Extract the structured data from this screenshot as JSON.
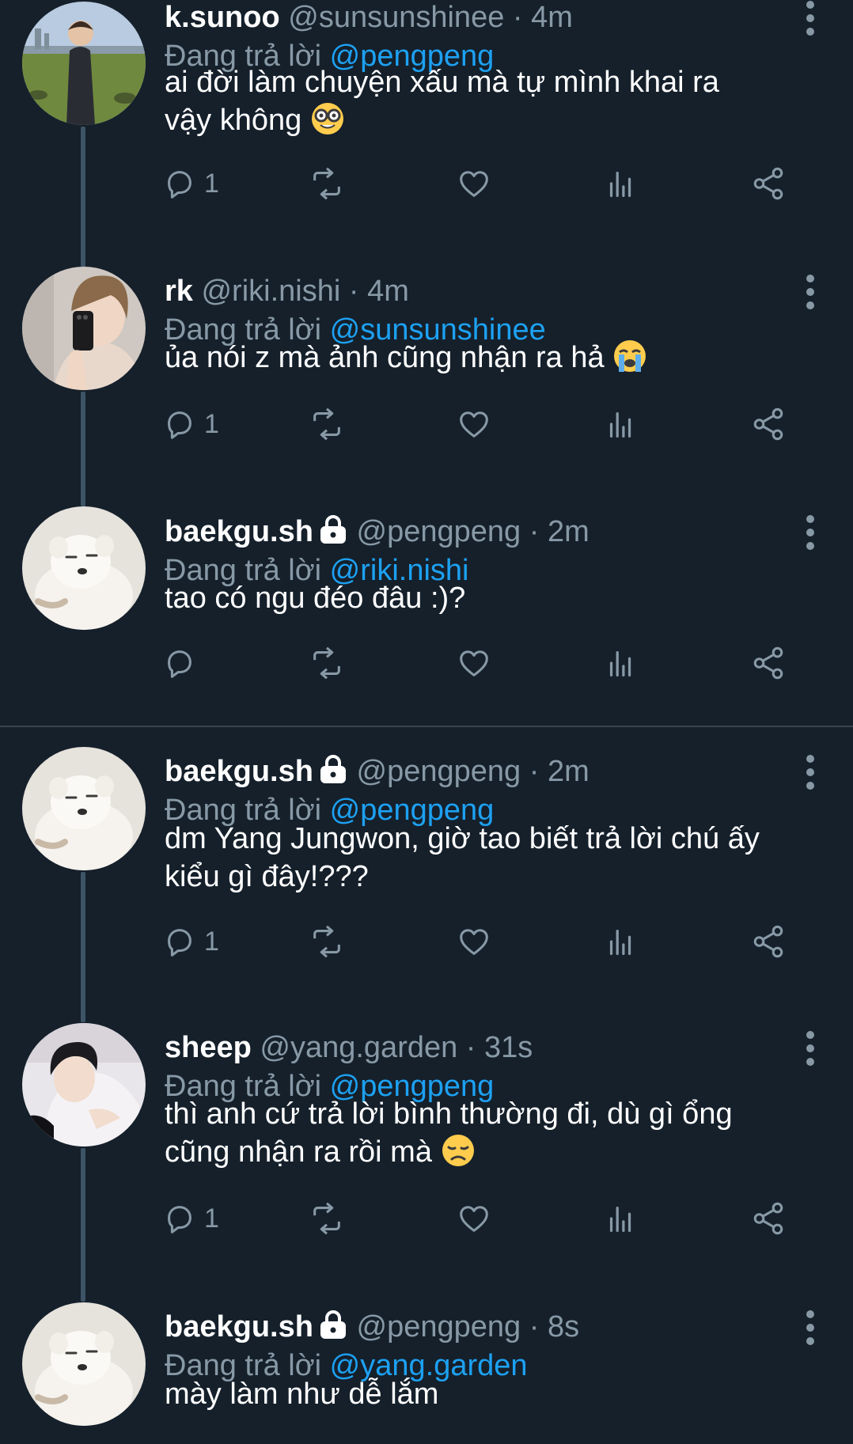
{
  "tweets": [
    {
      "name": "k.sunoo",
      "handle": "@sunsunshinee",
      "time": "4m",
      "replying_prefix": "Đang trả lời",
      "replying_to": "@pengpeng",
      "lines": [
        "ai đời làm chuyện xấu mà tự mình khai ra",
        "vậy không"
      ],
      "emoji": "nerd-face",
      "locked": false,
      "reply_count": "1",
      "avatar": "man-standing-on-grass"
    },
    {
      "name": "rk",
      "handle": "@riki.nishi",
      "time": "4m",
      "replying_prefix": "Đang trả lời",
      "replying_to": "@sunsunshinee",
      "lines": [
        "ủa nói z mà ảnh cũng nhận ra hả"
      ],
      "emoji": "loudly-crying-face",
      "locked": false,
      "reply_count": "1",
      "avatar": "mirror-selfie"
    },
    {
      "name": "baekgu.sh",
      "handle": "@pengpeng",
      "time": "2m",
      "replying_prefix": "Đang trả lời",
      "replying_to": "@riki.nishi",
      "lines": [
        "tao có ngu đéo đâu :)?"
      ],
      "emoji": "",
      "locked": true,
      "reply_count": "",
      "avatar": "white-puppy"
    },
    {
      "name": "baekgu.sh",
      "handle": "@pengpeng",
      "time": "2m",
      "replying_prefix": "Đang trả lời",
      "replying_to": "@pengpeng",
      "lines": [
        "dm Yang Jungwon, giờ tao biết trả lời chú ấy",
        "kiểu gì đây!???"
      ],
      "emoji": "",
      "locked": true,
      "reply_count": "1",
      "avatar": "white-puppy"
    },
    {
      "name": "sheep",
      "handle": "@yang.garden",
      "time": "31s",
      "replying_prefix": "Đang trả lời",
      "replying_to": "@pengpeng",
      "lines": [
        "thì anh cứ trả lời bình thường đi, dù gì ổng",
        "cũng nhận ra rồi mà"
      ],
      "emoji": "disappointed-face",
      "locked": false,
      "reply_count": "1",
      "avatar": "boy-with-pillow"
    },
    {
      "name": "baekgu.sh",
      "handle": "@pengpeng",
      "time": "8s",
      "replying_prefix": "Đang trả lời",
      "replying_to": "@yang.garden",
      "lines": [
        "mày làm như dễ lắm"
      ],
      "emoji": "",
      "locked": true,
      "reply_count": "",
      "avatar": "white-puppy"
    }
  ],
  "icons": {
    "reply": "speech-bubble-icon",
    "retweet": "retweet-icon",
    "like": "heart-icon",
    "views": "bar-chart-icon",
    "share": "share-icon",
    "more": "more-vertical-icon",
    "lock": "lock-icon"
  },
  "colors": {
    "background": "#15202b",
    "secondary_text": "#8899a6",
    "mention": "#1da1f2",
    "thread_line": "#3d5466",
    "divider": "#38444d"
  }
}
